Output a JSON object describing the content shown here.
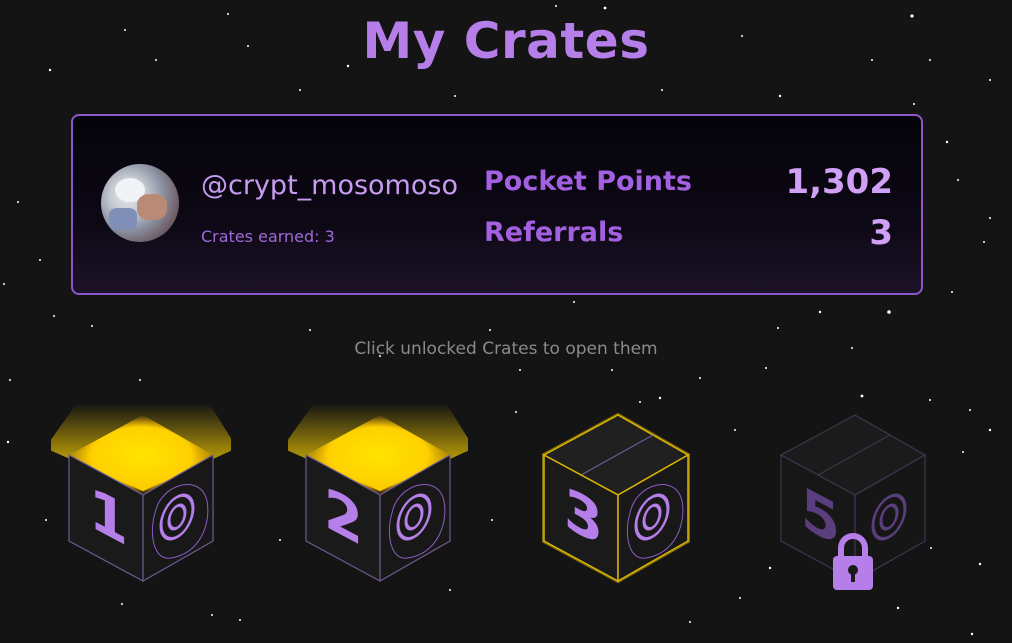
{
  "page": {
    "title": "My Crates"
  },
  "profile": {
    "username": "@crypt_mosomoso",
    "crates_earned": "Crates earned: 3"
  },
  "stats": [
    {
      "label": "Pocket Points",
      "value": "1,302"
    },
    {
      "label": "Referrals",
      "value": "3"
    }
  ],
  "hint": "Click unlocked Crates to open them",
  "crates": [
    {
      "number": "1",
      "state": "opened",
      "icon": "spiral-emblem-icon"
    },
    {
      "number": "2",
      "state": "opened",
      "icon": "spiral-emblem-icon"
    },
    {
      "number": "3",
      "state": "unlocked",
      "icon": "spiral-emblem-icon"
    },
    {
      "number": "5",
      "state": "locked",
      "icon": "padlock-icon"
    }
  ],
  "colors": {
    "accent": "#b57ee8",
    "glow": "#ffd400",
    "background": "#141414"
  }
}
